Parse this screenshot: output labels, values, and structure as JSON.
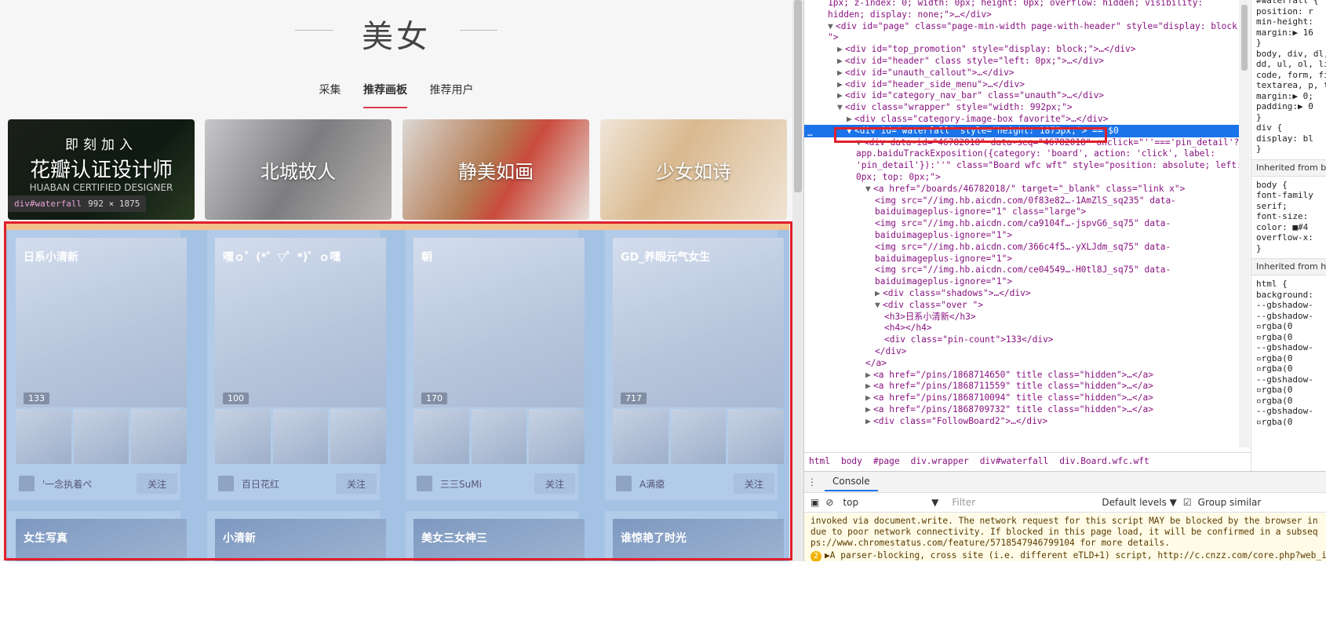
{
  "page": {
    "title": "美女",
    "tabs": [
      "采集",
      "推荐画板",
      "推荐用户"
    ],
    "active_tab": 1
  },
  "banners": [
    {
      "line1": "即刻加入",
      "line2": "花瓣认证设计师",
      "line3": "HUABAN CERTIFIED DESIGNER"
    },
    {
      "label": "北城故人"
    },
    {
      "label": "静美如画"
    },
    {
      "label": "少女如诗"
    }
  ],
  "tooltip": {
    "tag": "div#waterfall",
    "size": "992 × 1875"
  },
  "boards": [
    {
      "title": "日系小清新",
      "count": "133",
      "user": "'一念执着ぺ",
      "follow": "关注"
    },
    {
      "title": "嘿ｏ゜(*゜▽゜*)゜ｏ嘿",
      "count": "100",
      "user": "百日花红",
      "follow": "关注"
    },
    {
      "title": "朝",
      "count": "170",
      "user": "三三SuMi",
      "follow": "关注"
    },
    {
      "title": "GD_养眼元气女生",
      "count": "717",
      "user": "A满瘪",
      "follow": "关注"
    }
  ],
  "boards_row2": [
    "女生写真",
    "小清新",
    "美女三女神三",
    "谁惊艳了时光"
  ],
  "devtools": {
    "lines": [
      {
        "indent": 0,
        "text": "1px; z-index: 0; width: 0px; height: 0px; overflow: hidden; visibility:"
      },
      {
        "indent": 0,
        "text": "hidden; display: none;\">…</div>"
      },
      {
        "indent": 0,
        "tri": "▼",
        "text": "<div id=\"page\" class=\"page-min-width page-with-header\" style=\"display: block;"
      },
      {
        "indent": 0,
        "text": "\">"
      },
      {
        "indent": 1,
        "tri": "▶",
        "text": "<div id=\"top_promotion\" style=\"display: block;\">…</div>"
      },
      {
        "indent": 1,
        "tri": "▶",
        "text": "<div id=\"header\" class style=\"left: 0px;\">…</div>"
      },
      {
        "indent": 1,
        "tri": "▶",
        "text": "<div id=\"unauth_callout\">…</div>"
      },
      {
        "indent": 1,
        "tri": "▶",
        "text": "<div id=\"header_side_menu\">…</div>"
      },
      {
        "indent": 1,
        "tri": "▶",
        "text": "<div id=\"category_nav_bar\" class=\"unauth\">…</div>"
      },
      {
        "indent": 1,
        "tri": "▼",
        "text": "<div class=\"wrapper\" style=\"width: 992px;\">"
      },
      {
        "indent": 2,
        "tri": "▶",
        "text": "<div class=\"category-image-box favorite\">…</div>"
      },
      {
        "indent": 2,
        "tri": "▼",
        "text": "<div id=\"waterfall\" style=\"height: 1875px;\"> == $0",
        "sel": true
      },
      {
        "indent": 3,
        "tri": "▼",
        "text": "<div data-id=\"46782018\" data-seq=\"46782018\" onclick=\"''==='pin_detail'?"
      },
      {
        "indent": 3,
        "text": "app.baiduTrackExposition({category: 'board', action: 'click', label:"
      },
      {
        "indent": 3,
        "text": "'pin_detail'}):''\" class=\"Board wfc wft\" style=\"position: absolute; left:"
      },
      {
        "indent": 3,
        "text": "0px; top: 0px;\">"
      },
      {
        "indent": 4,
        "tri": "▼",
        "text": "<a href=\"/boards/46782018/\" target=\"_blank\" class=\"link  x\">"
      },
      {
        "indent": 5,
        "text": "<img src=\"//img.hb.aicdn.com/0f83e82…-1AmZlS_sq235\" data-"
      },
      {
        "indent": 5,
        "text": "baiduimageplus-ignore=\"1\" class=\"large\">"
      },
      {
        "indent": 5,
        "text": "<img src=\"//img.hb.aicdn.com/ca9104f…-jspvG6_sq75\" data-"
      },
      {
        "indent": 5,
        "text": "baiduimageplus-ignore=\"1\">"
      },
      {
        "indent": 5,
        "text": "<img src=\"//img.hb.aicdn.com/366c4f5…-yXLJdm_sq75\" data-"
      },
      {
        "indent": 5,
        "text": "baiduimageplus-ignore=\"1\">"
      },
      {
        "indent": 5,
        "text": "<img src=\"//img.hb.aicdn.com/ce04549…-H0tl8J_sq75\" data-"
      },
      {
        "indent": 5,
        "text": "baiduimageplus-ignore=\"1\">"
      },
      {
        "indent": 5,
        "tri": "▶",
        "text": "<div class=\"shadows\">…</div>"
      },
      {
        "indent": 5,
        "tri": "▼",
        "text": "<div class=\"over \">"
      },
      {
        "indent": 6,
        "text": "<h3>日系小清新</h3>"
      },
      {
        "indent": 6,
        "text": "<h4></h4>"
      },
      {
        "indent": 6,
        "text": "<div class=\"pin-count\">133</div>"
      },
      {
        "indent": 5,
        "text": "</div>"
      },
      {
        "indent": 4,
        "text": "</a>"
      },
      {
        "indent": 4,
        "tri": "▶",
        "text": "<a href=\"/pins/1868714650\" title class=\"hidden\">…</a>"
      },
      {
        "indent": 4,
        "tri": "▶",
        "text": "<a href=\"/pins/1868711559\" title class=\"hidden\">…</a>"
      },
      {
        "indent": 4,
        "tri": "▶",
        "text": "<a href=\"/pins/1868710094\" title class=\"hidden\">…</a>"
      },
      {
        "indent": 4,
        "tri": "▶",
        "text": "<a href=\"/pins/1868709732\" title class=\"hidden\">…</a>"
      },
      {
        "indent": 4,
        "tri": "▶",
        "text": "<div class=\"FollowBoard2\">…</div>"
      }
    ],
    "breadcrumb": [
      "html",
      "body",
      "#page",
      "div.wrapper",
      "div#waterfall",
      "div.Board.wfc.wft"
    ],
    "styles": [
      "#waterfall {",
      "  position: r",
      "  min-height:",
      "  margin:▶ 16",
      "}",
      "body, div, dl,",
      "dd, ul, ol, li",
      "code, form, fi",
      "textarea, p, t",
      "  margin:▶ 0;",
      "  padding:▶ 0",
      "}",
      "div {",
      "  display: bl",
      "}"
    ],
    "inherited1": "Inherited from b",
    "body_styles": [
      "body {",
      "  font-family",
      "     serif;",
      "  font-size:",
      "  color: ■#4",
      "  overflow-x:",
      "}"
    ],
    "inherited2": "Inherited from h",
    "html_styles": [
      "html {",
      "  background:",
      "  --gbshadow-",
      "  --gbshadow-",
      "    ▫rgba(0",
      "    ▫rgba(0",
      "  --gbshadow-",
      "    ▫rgba(0",
      "    ▫rgba(0",
      "  --gbshadow-",
      "    ▫rgba(0",
      "    ▫rgba(0",
      "  --gbshadow-",
      "    ▫rgba(0"
    ],
    "console_tab": "Console",
    "context": "top",
    "filter_placeholder": "Filter",
    "levels": "Default levels ▼",
    "group_similar": "Group similar",
    "messages": [
      "invoked via document.write. The network request for this script MAY be blocked by the browser in",
      "due to poor network connectivity. If blocked in this page load, it will be confirmed in a subseq",
      "ps://www.chromestatus.com/feature/5718547946799104 for more details.",
      "▶A parser-blocking, cross site (i.e. different eTLD+1) script, http://c.cnzz.com/core.php?web_id"
    ],
    "warn_count": "2"
  }
}
